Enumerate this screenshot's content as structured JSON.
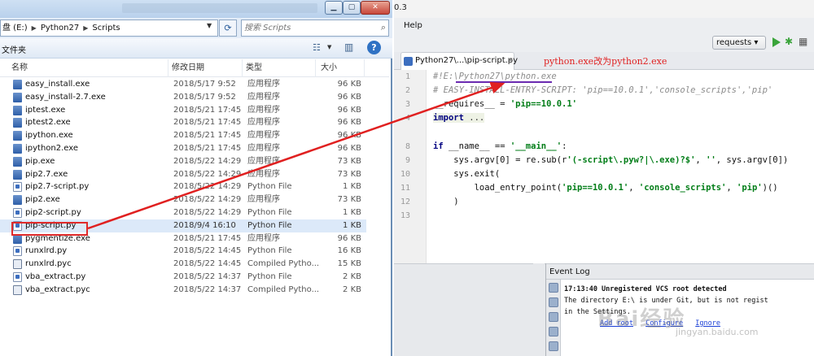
{
  "explorer": {
    "address_segments": [
      "盘 (E:)",
      "Python27",
      "Scripts"
    ],
    "search_placeholder": "搜索 Scripts",
    "folder_label": "文件夹",
    "columns": {
      "name": "名称",
      "date": "修改日期",
      "type": "类型",
      "size": "大小"
    },
    "files": [
      {
        "name": "easy_install.exe",
        "date": "2018/5/17 9:52",
        "type": "应用程序",
        "size": "96 KB",
        "icon": "exe"
      },
      {
        "name": "easy_install-2.7.exe",
        "date": "2018/5/17 9:52",
        "type": "应用程序",
        "size": "96 KB",
        "icon": "exe"
      },
      {
        "name": "iptest.exe",
        "date": "2018/5/21 17:45",
        "type": "应用程序",
        "size": "96 KB",
        "icon": "exe"
      },
      {
        "name": "iptest2.exe",
        "date": "2018/5/21 17:45",
        "type": "应用程序",
        "size": "96 KB",
        "icon": "exe"
      },
      {
        "name": "ipython.exe",
        "date": "2018/5/21 17:45",
        "type": "应用程序",
        "size": "96 KB",
        "icon": "exe"
      },
      {
        "name": "ipython2.exe",
        "date": "2018/5/21 17:45",
        "type": "应用程序",
        "size": "96 KB",
        "icon": "exe"
      },
      {
        "name": "pip.exe",
        "date": "2018/5/22 14:29",
        "type": "应用程序",
        "size": "73 KB",
        "icon": "exe"
      },
      {
        "name": "pip2.7.exe",
        "date": "2018/5/22 14:29",
        "type": "应用程序",
        "size": "73 KB",
        "icon": "exe"
      },
      {
        "name": "pip2.7-script.py",
        "date": "2018/5/22 14:29",
        "type": "Python File",
        "size": "1 KB",
        "icon": "py"
      },
      {
        "name": "pip2.exe",
        "date": "2018/5/22 14:29",
        "type": "应用程序",
        "size": "73 KB",
        "icon": "exe"
      },
      {
        "name": "pip2-script.py",
        "date": "2018/5/22 14:29",
        "type": "Python File",
        "size": "1 KB",
        "icon": "py"
      },
      {
        "name": "pip-script.py",
        "date": "2018/9/4 16:10",
        "type": "Python File",
        "size": "1 KB",
        "icon": "py"
      },
      {
        "name": "pygmentize.exe",
        "date": "2018/5/21 17:45",
        "type": "应用程序",
        "size": "96 KB",
        "icon": "exe"
      },
      {
        "name": "runxlrd.py",
        "date": "2018/5/22 14:45",
        "type": "Python File",
        "size": "16 KB",
        "icon": "py"
      },
      {
        "name": "runxlrd.pyc",
        "date": "2018/5/22 14:45",
        "type": "Compiled Pytho...",
        "size": "15 KB",
        "icon": "pyc"
      },
      {
        "name": "vba_extract.py",
        "date": "2018/5/22 14:37",
        "type": "Python File",
        "size": "2 KB",
        "icon": "py"
      },
      {
        "name": "vba_extract.pyc",
        "date": "2018/5/22 14:37",
        "type": "Compiled Pytho...",
        "size": "2 KB",
        "icon": "pyc"
      }
    ],
    "selected_file": "pip-script.py"
  },
  "ide": {
    "version_fragment": "0.3",
    "menu_help": "Help",
    "run_config": "requests ▾",
    "tab_label": "Python27\\...\\pip-script.py",
    "annotation": "python.exe改为python2.exe",
    "line_numbers": [
      "1",
      "2",
      "3",
      "4",
      "8",
      "9",
      "10",
      "11",
      "12",
      "13"
    ],
    "code": {
      "l1": "#!E:\\Python27\\python.exe",
      "l2": "# EASY-INSTALL-ENTRY-SCRIPT: 'pip==10.0.1','console_scripts','pip'",
      "l3_a": "__requires__ = ",
      "l3_b": "'pip==10.0.1'",
      "l4_a": "import",
      "l4_b": " ...",
      "l8_a": "if",
      "l8_b": " __name__ == ",
      "l8_c": "'__main__'",
      "l8_d": ":",
      "l9_a": "    sys.argv[0] = re.sub(r",
      "l9_b": "'(-script\\.pyw?|\\.exe)?$'",
      "l9_c": ", ",
      "l9_d": "''",
      "l9_e": ", sys.argv[0])",
      "l10": "    sys.exit(",
      "l11_a": "        load_entry_point(",
      "l11_b": "'pip==10.0.1'",
      "l11_c": ", ",
      "l11_d": "'console_scripts'",
      "l11_e": ", ",
      "l11_f": "'pip'",
      "l11_g": ")()",
      "l12": "    )"
    },
    "event_log": {
      "title": "Event Log",
      "line1": "17:13:40 Unregistered VCS root detected",
      "line2": "         The directory E:\\ is under Git, but is not regist",
      "line3": "in the Settings.",
      "links": [
        "Add root",
        "Configure",
        "Ignore"
      ]
    }
  },
  "watermark": {
    "text": "Bai经验",
    "url": "jingyan.baidu.com"
  },
  "colors": {
    "annotation_red": "#e02020",
    "selection": "#dce9f9",
    "run_green": "#3aa43a"
  }
}
